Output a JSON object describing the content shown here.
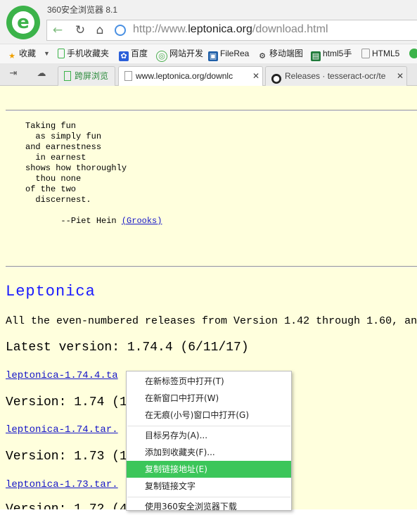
{
  "window": {
    "title": "360安全浏览器 8.1"
  },
  "address_bar": {
    "url_prefix": "http://www.",
    "url_host": "leptonica.org",
    "url_path": "/download.html"
  },
  "bookmarks": [
    {
      "label": "收藏",
      "icon": "star-icon"
    },
    {
      "label": "手机收藏夹",
      "icon": "phone-icon"
    },
    {
      "label": "百度",
      "icon": "baidu-paw-icon"
    },
    {
      "label": "网站开发",
      "icon": "site-icon"
    },
    {
      "label": "FileRea",
      "icon": "filerea-icon"
    },
    {
      "label": "移动端图",
      "icon": "mobile-icon"
    },
    {
      "label": "html5手",
      "icon": "html5-icon"
    },
    {
      "label": "HTML5",
      "icon": "page-icon"
    }
  ],
  "tabs": [
    {
      "label": "跨屏浏览",
      "icon": "phone-icon"
    },
    {
      "label": "www.leptonica.org/downlc",
      "icon": "page-icon"
    },
    {
      "label": "Releases · tesseract-ocr/te",
      "icon": "github-icon"
    }
  ],
  "page": {
    "poem": "Taking fun\n  as simply fun\nand earnestness\n  in earnest\nshows how thoroughly\n  thou none\nof the two\n  discernest.",
    "attribution_prefix": "--Piet Hein ",
    "attribution_link": "(Grooks)",
    "heading": "Leptonica",
    "releases_text": "All the even-numbered releases from Version 1.42 through 1.60, an",
    "latest": "Latest version: 1.74.4 (6/11/17)",
    "link1": "leptonica-1.74.4.ta",
    "v174": "Version: 1.74 (1",
    "link2": "leptonica-1.74.tar.",
    "v173": "Version: 1.73 (1",
    "link3": "leptonica-1.73.tar.",
    "v172": "Version: 1.72 (4"
  },
  "context_menu": {
    "items": [
      "在新标签页中打开(T)",
      "在新窗口中打开(W)",
      "在无痕(小号)窗口中打开(G)",
      "目标另存为(A)...",
      "添加到收藏夹(F)...",
      "复制链接地址(E)",
      "复制链接文字",
      "使用360安全浏览器下载"
    ],
    "highlighted": "复制链接地址(E)"
  },
  "colors": {
    "accent": "#3cc65a",
    "page_bg": "#ffffdd",
    "link": "#1515c8",
    "heading": "#1a1aff"
  }
}
